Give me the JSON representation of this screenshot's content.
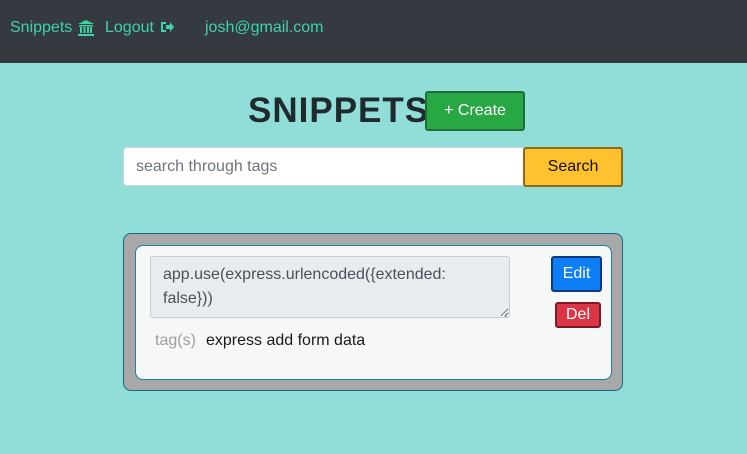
{
  "nav": {
    "snippets_label": "Snippets",
    "snippets_icon": "bank-icon",
    "logout_label": "Logout",
    "logout_icon": "logout-icon",
    "email": "josh@gmail.com"
  },
  "header": {
    "title": "SNIPPETS",
    "create_label": "+ Create"
  },
  "search": {
    "placeholder": "search through tags",
    "button_label": "Search"
  },
  "snippet": {
    "code": "app.use(express.urlencoded({extended: false}))",
    "edit_label": "Edit",
    "delete_label": "Del",
    "tags_label": "tag(s)",
    "tags_value": "express add form data"
  },
  "colors": {
    "background": "#91ded8",
    "navbar": "#343a40",
    "nav_link": "#3fd3a6",
    "create": "#28a745",
    "search": "#ffc12e",
    "edit": "#0d7ef6",
    "delete": "#dc3545"
  }
}
